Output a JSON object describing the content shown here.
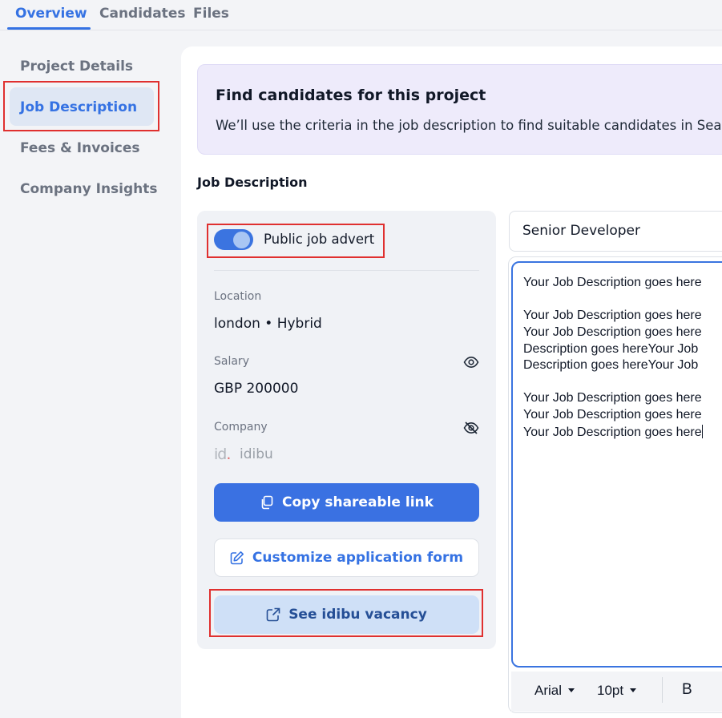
{
  "tabs": [
    {
      "label": "Overview",
      "active": true
    },
    {
      "label": "Candidates",
      "active": false
    },
    {
      "label": "Files",
      "active": false
    }
  ],
  "sidebar": {
    "items": [
      {
        "label": "Project Details",
        "selected": false
      },
      {
        "label": "Job Description",
        "selected": true
      },
      {
        "label": "Fees & Invoices",
        "selected": false
      },
      {
        "label": "Company Insights",
        "selected": false
      }
    ]
  },
  "banner": {
    "title": "Find candidates for this project",
    "subtitle": "We’ll use the criteria in the job description to find suitable candidates in Sea"
  },
  "section_title": "Job Description",
  "advert": {
    "toggle_label": "Public job advert",
    "toggle_on": true,
    "location_label": "Location",
    "location_value": "london • Hybrid",
    "salary_label": "Salary",
    "salary_value": "GBP 200000",
    "company_label": "Company",
    "company_logo_text": "id",
    "company_value": "idibu",
    "copy_link_label": "Copy shareable link",
    "customize_form_label": "Customize application form",
    "see_vacancy_label": "See idibu vacancy"
  },
  "editor": {
    "job_title": "Senior Developer",
    "lines": [
      "Your Job Description goes here",
      "",
      "Your Job Description goes here",
      "Your Job Description goes here",
      "Description goes hereYour Job",
      "Description goes hereYour Job",
      "",
      "Your Job Description goes here",
      "Your Job Description goes here",
      "Your Job Description goes here"
    ],
    "toolbar": {
      "font": "Arial",
      "size": "10pt",
      "bold": "B"
    }
  },
  "colors": {
    "accent": "#3572e3",
    "highlight": "#e0302f",
    "banner_bg": "#eeebfb"
  }
}
